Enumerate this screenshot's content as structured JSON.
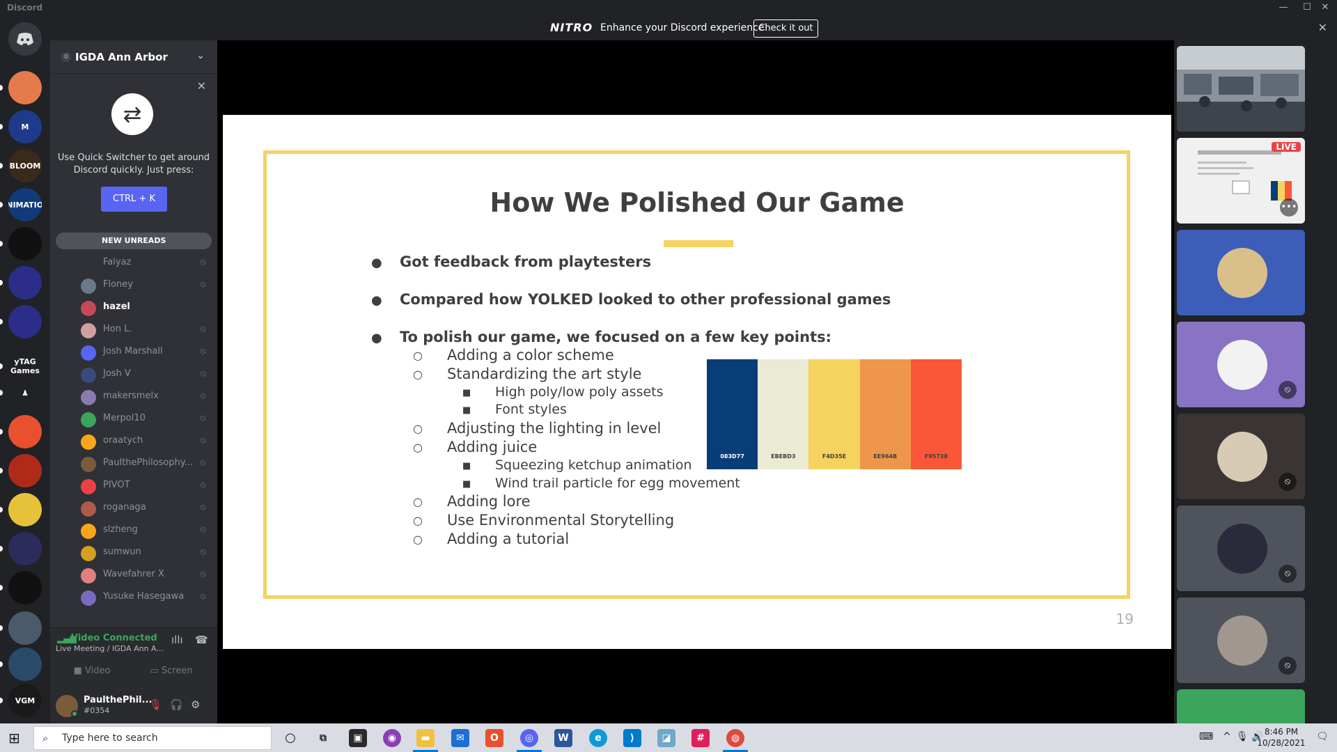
{
  "window": {
    "title": "Discord",
    "controls": [
      "—",
      "☐",
      "✕"
    ]
  },
  "nitro_banner": {
    "logo": "NITRO",
    "message": "Enhance your Discord experience!",
    "cta": "Check it out",
    "close": "✕"
  },
  "guild": {
    "name": "IGDA Ann Arbor",
    "boost": "0"
  },
  "quick_switcher": {
    "text": "Use Quick Switcher to get around Discord quickly. Just press:",
    "shortcut": "CTRL + K"
  },
  "new_unreads": "NEW UNREADS",
  "servers": [
    {
      "label": "",
      "color": "#e57a4b"
    },
    {
      "label": "M",
      "color": "#1e3a8a"
    },
    {
      "label": "BLOOM",
      "color": "#3a2a1a"
    },
    {
      "label": "ANIMATION",
      "color": "#123a7a"
    },
    {
      "label": "",
      "color": "#111111"
    },
    {
      "label": "",
      "color": "#2b2d88"
    },
    {
      "label": "",
      "color": "#2b2d88"
    },
    {
      "label": "yTAG Games",
      "color": "#202225"
    },
    {
      "label": "♟",
      "color": "#202225"
    },
    {
      "label": "",
      "color": "#e8502e"
    },
    {
      "label": "",
      "color": "#b02a1a"
    },
    {
      "label": "",
      "color": "#e6c23a"
    },
    {
      "label": "",
      "color": "#2c2c5c"
    },
    {
      "label": "",
      "color": "#111111"
    },
    {
      "label": "",
      "color": "#4a5a6a"
    },
    {
      "label": "",
      "color": "#2a4a6a"
    },
    {
      "label": "VGM",
      "color": "#1a1a1a"
    }
  ],
  "members": [
    {
      "name": "Faiyaz",
      "active": false,
      "color": "#2f3136"
    },
    {
      "name": "Floney",
      "active": false,
      "color": "#6a7a8a"
    },
    {
      "name": "hazel",
      "active": true,
      "color": "#c44a5a"
    },
    {
      "name": "Hon L.",
      "active": false,
      "color": "#d0a0a0"
    },
    {
      "name": "Josh Marshall",
      "active": false,
      "color": "#5865f2"
    },
    {
      "name": "Josh V",
      "active": false,
      "color": "#3a4a7a"
    },
    {
      "name": "makersmelx",
      "active": false,
      "color": "#8a7ab0"
    },
    {
      "name": "Merpol10",
      "active": false,
      "color": "#3ba55d"
    },
    {
      "name": "oraatych",
      "active": false,
      "color": "#faa61a"
    },
    {
      "name": "PaulthePhilosophy...",
      "active": false,
      "color": "#7a5c3c"
    },
    {
      "name": "PIVOT",
      "active": false,
      "color": "#ed4245"
    },
    {
      "name": "roganaga",
      "active": false,
      "color": "#b05a4a"
    },
    {
      "name": "slzheng",
      "active": false,
      "color": "#faa61a"
    },
    {
      "name": "sumwun",
      "active": false,
      "color": "#d4a020"
    },
    {
      "name": "Wavefahrer X",
      "active": false,
      "color": "#e08080"
    },
    {
      "name": "Yusuke Hasegawa",
      "active": false,
      "color": "#7a6ac0"
    }
  ],
  "voice": {
    "status": "Video Connected",
    "channel": "Live Meeting / IGDA Ann A...",
    "video_label": "Video",
    "screen_label": "Screen"
  },
  "user": {
    "name": "PaulthePhil...",
    "discriminator": "#0354"
  },
  "slide": {
    "title": "How We Polished Our Game",
    "bullets": [
      "Got feedback from playtesters",
      "Compared how YOLKED looked to other professional games",
      "To polish our game, we focused on a few key points:"
    ],
    "sub": [
      "Adding a color scheme",
      "Standardizing the art style",
      "High poly/low poly assets",
      "Font styles",
      "Adjusting the lighting in level",
      "Adding juice",
      "Squeezing ketchup animation",
      "Wind trail particle for egg movement",
      "Adding lore",
      "Use Environmental Storytelling",
      "Adding a tutorial"
    ],
    "palette": [
      {
        "hex": "083D77",
        "color": "#083d77"
      },
      {
        "hex": "EBEBD3",
        "color": "#ebebd3"
      },
      {
        "hex": "F4D35E",
        "color": "#f4d35e"
      },
      {
        "hex": "EE964B",
        "color": "#ee964b"
      },
      {
        "hex": "F95738",
        "color": "#f95738"
      }
    ],
    "page_number": "19"
  },
  "participants": {
    "live_badge": "LIVE"
  },
  "taskbar": {
    "search_placeholder": "Type here to search",
    "time": "8:46 PM",
    "date": "10/28/2021"
  }
}
